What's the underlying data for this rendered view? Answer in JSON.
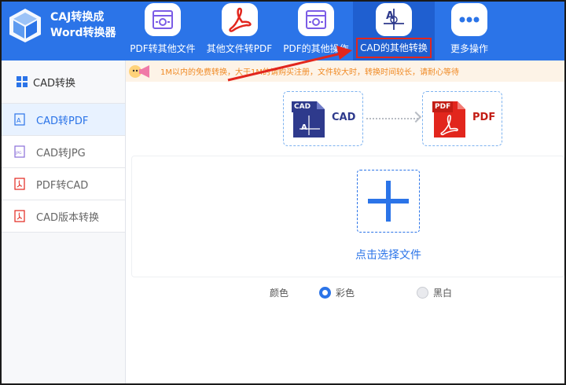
{
  "app": {
    "title_line1": "CAJ转换成",
    "title_line2": "Word转换器"
  },
  "nav": {
    "items": [
      {
        "label": "PDF转其他文件",
        "icon": "pdf-settings-icon"
      },
      {
        "label": "其他文件转PDF",
        "icon": "acrobat-icon"
      },
      {
        "label": "PDF的其他操作",
        "icon": "pdf-settings-icon"
      },
      {
        "label": "CAD的其他转换",
        "icon": "cad-icon"
      },
      {
        "label": "更多操作",
        "icon": "more-dots-icon"
      }
    ]
  },
  "sidebar": {
    "header": "CAD转换",
    "items": [
      {
        "label": "CAD转PDF",
        "active": true
      },
      {
        "label": "CAD转JPG",
        "active": false
      },
      {
        "label": "PDF转CAD",
        "active": false
      },
      {
        "label": "CAD版本转换",
        "active": false
      }
    ]
  },
  "notice": {
    "text": "1M以内的免费转换，大于1M的请购买注册，文件较大时，转换时间较长，请耐心等待"
  },
  "flow": {
    "from_badge": "CAD",
    "from_label": "CAD",
    "to_badge": "PDF",
    "to_label": "PDF"
  },
  "upload": {
    "label": "点击选择文件"
  },
  "color_option": {
    "label": "颜色",
    "options": [
      {
        "label": "彩色",
        "selected": true
      },
      {
        "label": "黑白",
        "selected": false
      }
    ]
  },
  "colors": {
    "brand_blue": "#2b74e8",
    "acrobat_red": "#e2261d",
    "notice_orange": "#f08a24",
    "cad_navy": "#2e3a8c"
  }
}
